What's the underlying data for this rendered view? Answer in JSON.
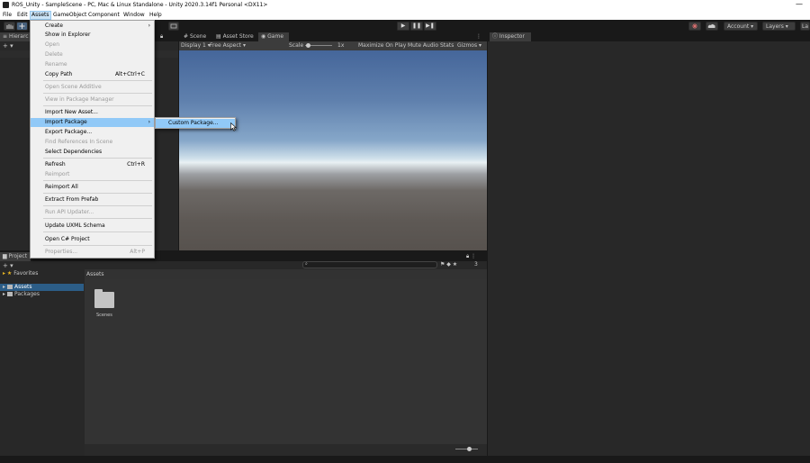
{
  "window": {
    "title": "ROS_Unity - SampleScene - PC, Mac & Linux Standalone - Unity 2020.3.14f1 Personal <DX11>",
    "minimize": "—"
  },
  "menubar": [
    "File",
    "Edit",
    "Assets",
    "GameObject",
    "Component",
    "Window",
    "Help"
  ],
  "toolbar": {
    "account": "Account",
    "layers": "Layers",
    "layout": "La",
    "play": "▶",
    "pause": "❚❚",
    "step": "▶❚"
  },
  "hierarchy": {
    "tab": "Hierarc",
    "add": "+ ▾"
  },
  "scene_tabs": [
    "Scene",
    "Asset Store",
    "Game"
  ],
  "game_toolbar": {
    "display": "Display 1",
    "aspect": "Free Aspect",
    "scale_label": "Scale",
    "scale_value": "1x",
    "maximize": "Maximize On Play",
    "mute": "Mute Audio",
    "stats": "Stats",
    "gizmos": "Gizmos"
  },
  "inspector": {
    "tab": "Inspector"
  },
  "assets_menu": {
    "items": [
      {
        "label": "Create",
        "shortcut": "",
        "submenu": true,
        "disabled": false
      },
      {
        "label": "Show in Explorer",
        "shortcut": "",
        "submenu": false,
        "disabled": false
      },
      {
        "label": "Open",
        "shortcut": "",
        "submenu": false,
        "disabled": true
      },
      {
        "label": "Delete",
        "shortcut": "",
        "submenu": false,
        "disabled": true
      },
      {
        "label": "Rename",
        "shortcut": "",
        "submenu": false,
        "disabled": true
      },
      {
        "label": "Copy Path",
        "shortcut": "Alt+Ctrl+C",
        "submenu": false,
        "disabled": false
      },
      {
        "label": "Open Scene Additive",
        "shortcut": "",
        "submenu": false,
        "disabled": true
      },
      {
        "label": "View in Package Manager",
        "shortcut": "",
        "submenu": false,
        "disabled": true
      },
      {
        "label": "Import New Asset...",
        "shortcut": "",
        "submenu": false,
        "disabled": false
      },
      {
        "label": "Import Package",
        "shortcut": "",
        "submenu": true,
        "disabled": false
      },
      {
        "label": "Export Package...",
        "shortcut": "",
        "submenu": false,
        "disabled": false
      },
      {
        "label": "Find References In Scene",
        "shortcut": "",
        "submenu": false,
        "disabled": true
      },
      {
        "label": "Select Dependencies",
        "shortcut": "",
        "submenu": false,
        "disabled": false
      },
      {
        "label": "Refresh",
        "shortcut": "Ctrl+R",
        "submenu": false,
        "disabled": false
      },
      {
        "label": "Reimport",
        "shortcut": "",
        "submenu": false,
        "disabled": true
      },
      {
        "label": "Reimport All",
        "shortcut": "",
        "submenu": false,
        "disabled": false
      },
      {
        "label": "Extract From Prefab",
        "shortcut": "",
        "submenu": false,
        "disabled": false
      },
      {
        "label": "Run API Updater...",
        "shortcut": "",
        "submenu": false,
        "disabled": true
      },
      {
        "label": "Update UXML Schema",
        "shortcut": "",
        "submenu": false,
        "disabled": false
      },
      {
        "label": "Open C# Project",
        "shortcut": "",
        "submenu": false,
        "disabled": false
      },
      {
        "label": "Properties...",
        "shortcut": "Alt+P",
        "submenu": false,
        "disabled": true
      }
    ],
    "highlighted": "Import Package"
  },
  "import_submenu": {
    "items": [
      "Custom Package..."
    ]
  },
  "project": {
    "tab": "Project",
    "favorites": "Favorites",
    "tree": [
      "Assets",
      "Packages"
    ],
    "breadcrumb": "Assets",
    "folders": [
      "Scenes"
    ],
    "hidden_count": "3"
  },
  "colors": {
    "editor_bg": "#191919",
    "panel_bg": "#282828",
    "menu_bg": "#f0f0f0",
    "menu_highlight": "#91c9f7"
  }
}
